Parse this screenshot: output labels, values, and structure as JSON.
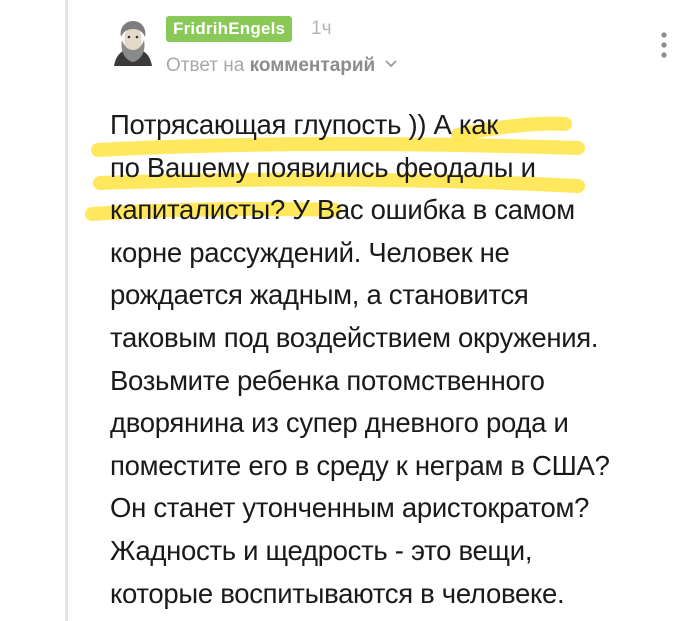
{
  "comment": {
    "author": "FridrihEngels",
    "time": "1ч",
    "reply_prefix": "Ответ на",
    "reply_link": "комментарий",
    "lines": [
      "Потрясающая глупость )) А как",
      "по Вашему появились феодалы и",
      "капиталисты? У Вас ошибка в самом",
      "корне рассуждений. Человек не",
      "рождается жадным, а становится",
      "таковым под воздействием окружения.",
      "Возьмите ребенка потомственного",
      "дворянина из супер дневного рода и",
      "поместите его в среду к неграм в США?",
      "Он станет утонченным аристократом?",
      "Жадность и щедрость - это вещи,",
      "которые воспитываются в человеке."
    ]
  },
  "icons": {
    "avatar": "portrait-avatar",
    "reply_chevron": "chevron-down-icon",
    "menu": "more-vertical-icon"
  },
  "colors": {
    "author_badge": "#8ac858",
    "highlight": "#ffe54c",
    "text": "#1a1a1a",
    "muted": "#a8a8a8"
  }
}
